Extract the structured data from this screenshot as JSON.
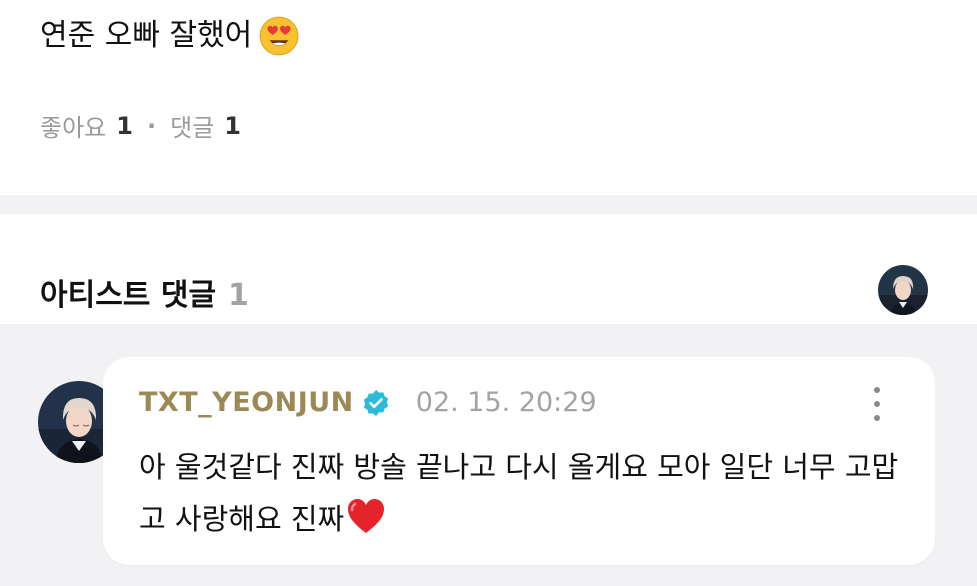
{
  "post": {
    "text": "연준 오빠 잘했어",
    "emoji": "heart-eyes-emoji",
    "likes_label": "좋아요",
    "likes_count": "1",
    "separator": "·",
    "comments_label": "댓글",
    "comments_count": "1"
  },
  "artist_section": {
    "title": "아티스트 댓글",
    "count": "1",
    "avatar": "artist-avatar"
  },
  "comment": {
    "author": "TXT_YEONJUN",
    "verified_icon": "verified-badge-icon",
    "timestamp": "02. 15. 20:29",
    "more_icon": "more-vertical-icon",
    "body": "아 울것같다 진짜 방솔 끝나고 다시 올게요 모아 일단 너무 고맙고 사랑해요 진짜",
    "emoji": "red-heart-emoji"
  },
  "colors": {
    "author": "#9c8a56",
    "verified": "#2bbbd8",
    "muted": "#9a9a9a",
    "background_gray": "#f2f2f4"
  }
}
